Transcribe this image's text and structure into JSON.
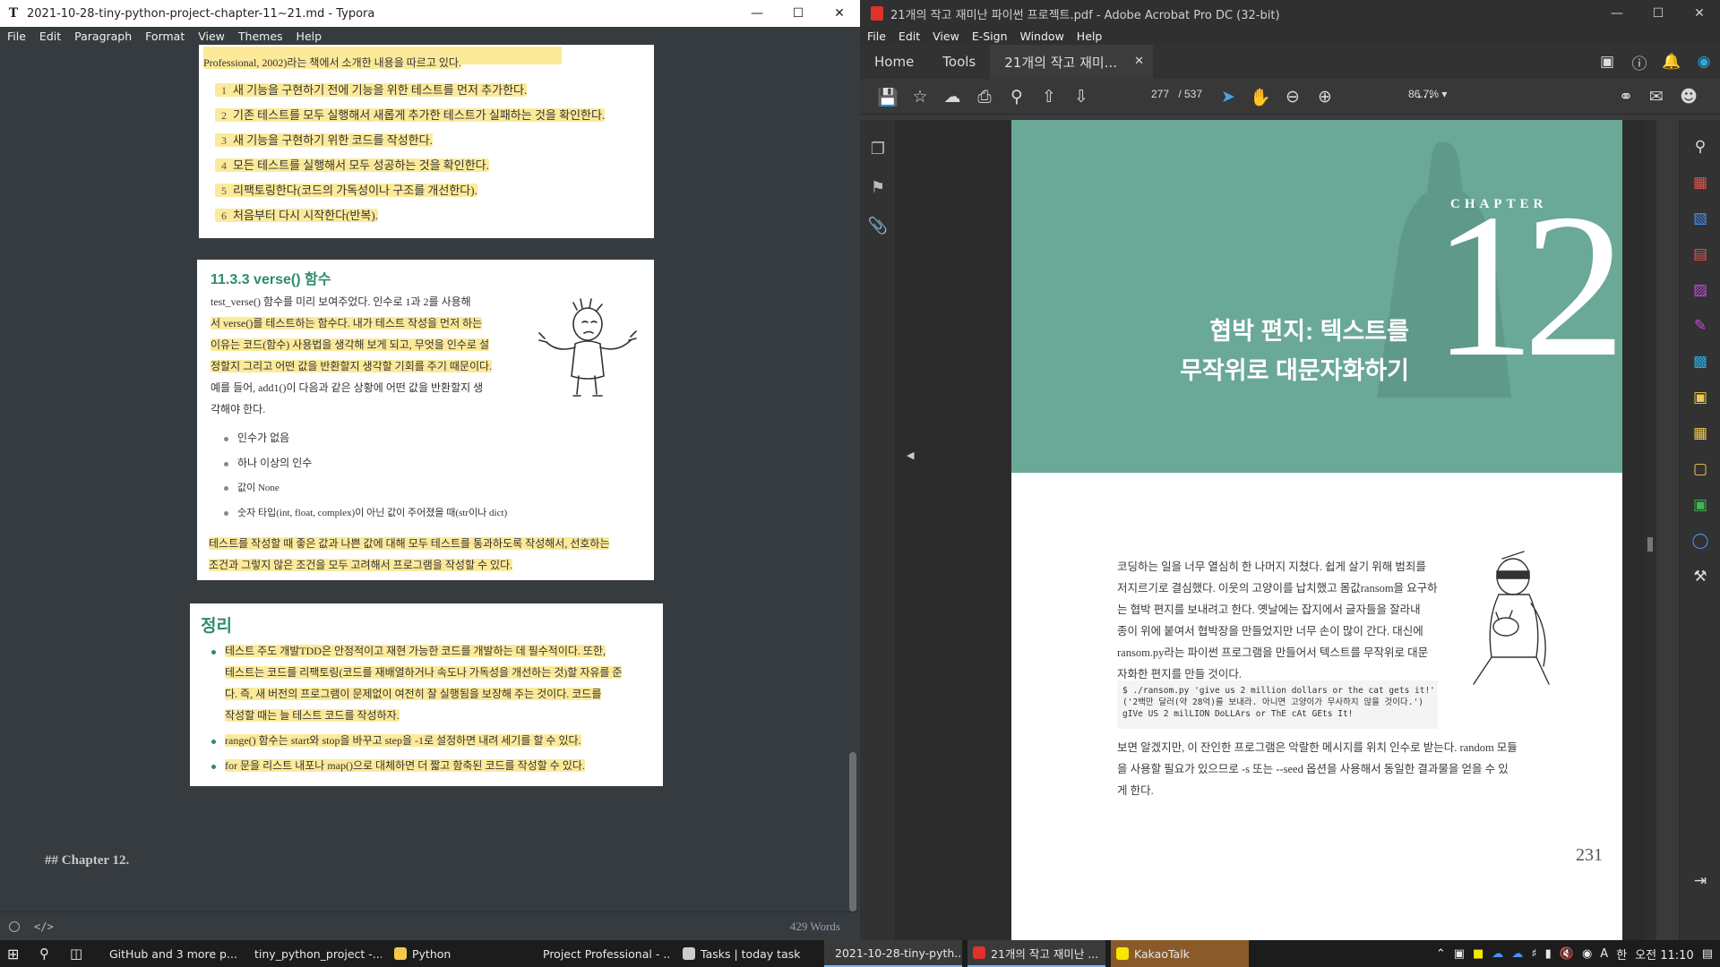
{
  "typora": {
    "title": "2021-10-28-tiny-python-project-chapter-11~21.md - Typora",
    "app_icon": "T",
    "menu": [
      "File",
      "Edit",
      "Paragraph",
      "Format",
      "View",
      "Themes",
      "Help"
    ],
    "block1": {
      "top_line": "Professional, 2002)라는 책에서 소개한 내용을 따르고 있다.",
      "steps": [
        {
          "n": "1",
          "text": "새 기능을 구현하기 전에 기능을 위한 테스트를 먼저 추가한다."
        },
        {
          "n": "2",
          "text": "기존 테스트를 모두 실행해서 새롭게 추가한 테스트가 실패하는 것을 확인한다."
        },
        {
          "n": "3",
          "text": "새 기능을 구현하기 위한 코드를 작성한다."
        },
        {
          "n": "4",
          "text": "모든 테스트를 실행해서 모두 성공하는 것을 확인한다."
        },
        {
          "n": "5",
          "text": "리팩토링한다(코드의 가독성이나 구조를 개선한다)."
        },
        {
          "n": "6",
          "text": "처음부터 다시 시작한다(반복)."
        }
      ]
    },
    "block2": {
      "heading": "11.3.3  verse() 함수",
      "lines": [
        "test_verse() 함수를 미리 보여주었다. 인수로 1과 2를 사용해",
        "서 verse()를 테스트하는 함수다. 내가 테스트 작성을 먼저 하는",
        "이유는 코드(함수) 사용법을 생각해 보게 되고, 무엇을 인수로 설",
        "정할지 그리고 어떤 값을 반환할지 생각할 기회를 주기 때문이다.",
        "예를 들어, add1()이 다음과 같은 상황에 어떤 값을 반환할지 생",
        "각해야 한다."
      ],
      "bullets": [
        "인수가 없음",
        "하나 이상의 인수",
        "값이 None",
        "숫자 타입(int, float, complex)이 아닌 값이 주어졌을 때(str이나 dict)"
      ],
      "closing": [
        "테스트를 작성할 때 좋은 값과 나쁜 값에 대해 모두 테스트를 통과하도록 작성해서, 선호하는",
        "조건과 그렇지 않은 조건을 모두 고려해서 프로그램을 작성할 수 있다."
      ]
    },
    "block3": {
      "heading": "정리",
      "bullets": [
        [
          "테스트 주도 개발TDD은 안정적이고 재현 가능한 코드를 개발하는 데 필수적이다. 또한,",
          "테스트는 코드를 리팩토링(코드를 재배열하거나 속도나 가독성을 개선하는 것)할 자유를 준",
          "다. 즉, 새 버전의 프로그램이 문제없이 여전히 잘 실행됨을 보장해 주는 것이다. 코드를",
          "작성할 때는 늘 테스트 코드를 작성하자."
        ],
        [
          "range() 함수는 start와 stop을 바꾸고 step을 -1로 설정하면 내려 세기를 할 수 있다."
        ],
        [
          "for 문을 리스트 내포나 map()으로 대체하면 더 짧고 함축된 코드를 작성할 수 있다."
        ]
      ]
    },
    "md_heading": "## Chapter 12.",
    "status": {
      "words": "429 Words",
      "source_icon": "</>"
    }
  },
  "acrobat": {
    "title": "21개의 작고 재미난 파이썬 프로젝트.pdf - Adobe Acrobat Pro DC (32-bit)",
    "menu": [
      "File",
      "Edit",
      "View",
      "E-Sign",
      "Window",
      "Help"
    ],
    "tabs": {
      "home": "Home",
      "tools": "Tools",
      "doc": "21개의 작고 재미..."
    },
    "page_current": "277",
    "page_total": "/  537",
    "zoom": "86.7%",
    "pdf": {
      "chapter_word": "CHAPTER",
      "chapter_num": "12",
      "title_lines": [
        "협박 편지: 텍스트를",
        "무작위로 대문자화하기"
      ],
      "para1": [
        "코딩하는 일을 너무 열심히 한 나머지 지쳤다. 쉽게 살기 위해 범죄를",
        "저지르기로 결심했다. 이웃의 고양이를 납치했고 몸값ransom을 요구하",
        "는 협박 편지를 보내려고 한다. 옛날에는 잡지에서 글자들을 잘라내",
        "종이 위에 붙여서 협박장을 만들었지만 너무 손이 많이 간다. 대신에",
        "ransom.py라는 파이썬 프로그램을 만들어서 텍스트를 무작위로 대문",
        "자화한 편지를 만들 것이다."
      ],
      "code": [
        "$ ./ransom.py 'give us 2 million dollars or the cat gets it!'",
        "('2백만 달러(약 28억)를 보내라. 아니면 고양이가 무사하지 않을 것이다.')",
        "gIVe US 2 milLION DoLLArs or ThE cAt GEts It!"
      ],
      "para2": [
        "보면 알겠지만, 이 잔인한 프로그램은 악랄한 메시지를 위치 인수로 받는다. random 모듈",
        "을 사용할 필요가 있으므로 -s 또는 --seed 옵션을 사용해서 동일한 결과물을 얻을 수 있",
        "게 한다."
      ],
      "page_number": "231"
    }
  },
  "taskbar": {
    "items": [
      {
        "label": "GitHub and 3 more p...",
        "color": "#1f8fd8"
      },
      {
        "label": "tiny_python_project -...",
        "color": "#1f8fd8"
      },
      {
        "label": "Python",
        "color": "#f2c94c"
      },
      {
        "label": "Project Professional - ...",
        "color": "#2e7d32"
      },
      {
        "label": "Tasks | today task",
        "color": "#cccccc"
      },
      {
        "label": "2021-10-28-tiny-pyth...",
        "color": "#dddddd"
      },
      {
        "label": "21개의 작고 재미난 ...",
        "color": "#e0312b"
      },
      {
        "label": "KakaoTalk",
        "color": "#f7e600"
      }
    ],
    "ime": "A",
    "lang": "한",
    "clock": "오전 11:10"
  }
}
